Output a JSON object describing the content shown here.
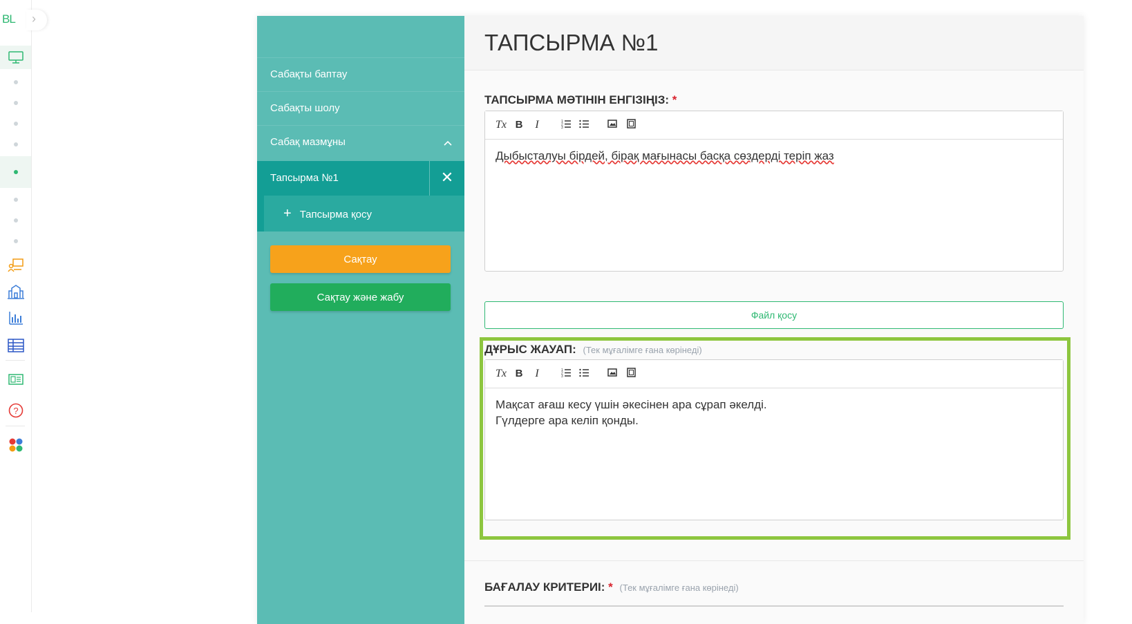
{
  "brand": {
    "logo": "BL",
    "expand_icon": "chevron-right-icon"
  },
  "rail": {
    "icons": [
      "monitor-icon",
      "classroom-icon",
      "school-icon",
      "bar-chart-icon",
      "table-icon",
      "news-icon",
      "help-icon",
      "apps-icon"
    ]
  },
  "sidebar": {
    "items": [
      {
        "label": "Сабақты баптау"
      },
      {
        "label": "Сабақты шолу"
      },
      {
        "label": "Сабақ мазмұны"
      }
    ],
    "task": {
      "label": "Тапсырма №1",
      "close_symbol": "✕"
    },
    "add_task": {
      "symbol": "+",
      "label": "Тапсырма қосу"
    },
    "save_label": "Сақтау",
    "save_close_label": "Сақтау және жабу"
  },
  "main": {
    "title": "ТАПСЫРМА №1",
    "task_text": {
      "label": "ТАПСЫРМА МӘТІНІН ЕНГІЗІҢІЗ:",
      "required": "*",
      "content": "Дыбысталуы бірдей, бірақ мағынасы басқа сөздерді теріп жаз"
    },
    "file_button": "Файл қосу",
    "answer": {
      "label": "ДҰРЫС ЖАУАП:",
      "hint": "(Тек мұғалімге ғана көрінеді)",
      "lines": [
        "Мақсат ағаш кесу үшін әкесінен ара сұрап әкелді.",
        "Гүлдерге ара келіп қонды."
      ]
    },
    "criteria": {
      "label": "БАҒАЛАУ КРИТЕРИІ:",
      "required": "*",
      "hint": "(Тек мұғалімге ғана көрінеді)"
    }
  },
  "toolbar": {
    "clear_format": "Tx",
    "bold": "B",
    "italic": "I"
  },
  "colors": {
    "sidebar": "#5bbcb4",
    "sidebar_active": "#139e95",
    "save": "#f7a21b",
    "save_close": "#21ad5c",
    "highlight": "#8dc63f",
    "brand": "#2eb872"
  }
}
